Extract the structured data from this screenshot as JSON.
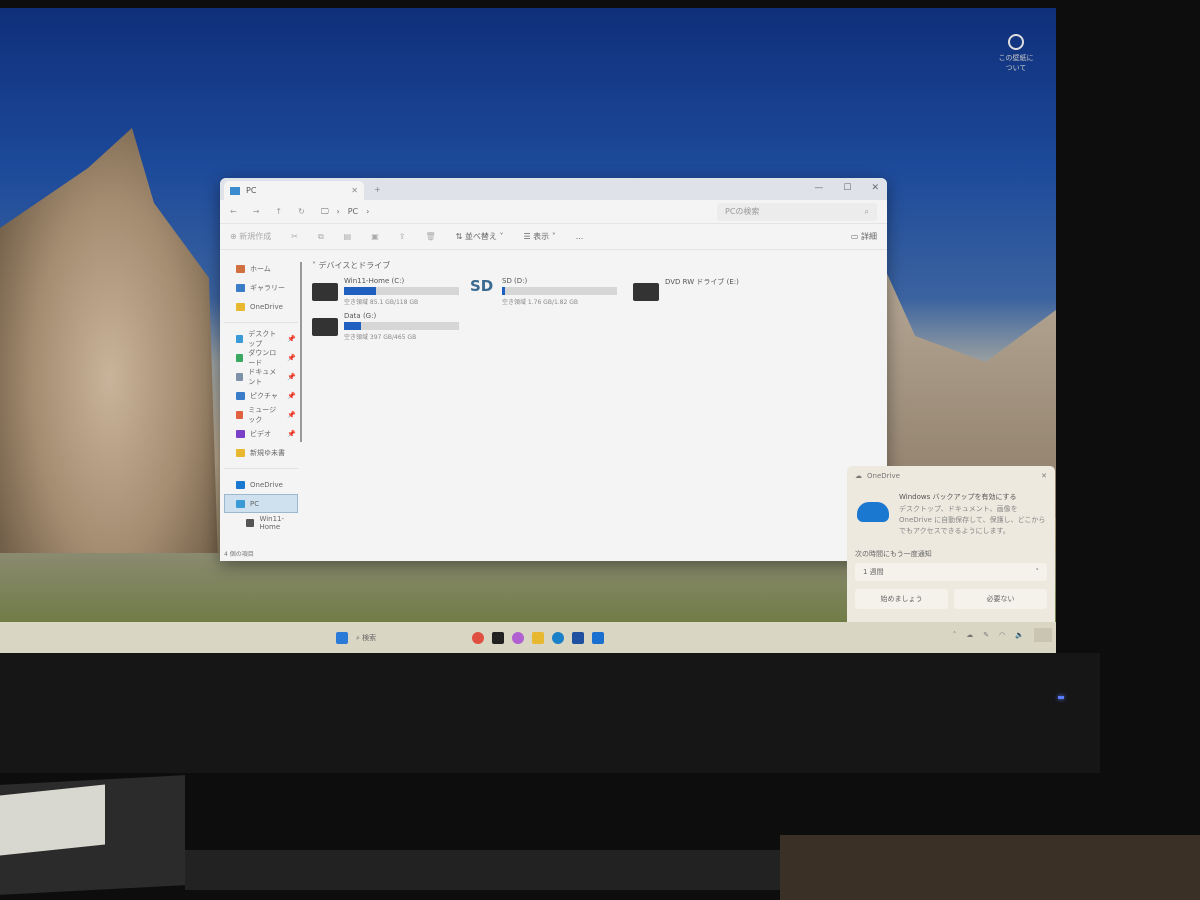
{
  "desktop": {
    "corner_text": "この壁紙について"
  },
  "explorer": {
    "tab_title": "PC",
    "breadcrumb": [
      "PC"
    ],
    "search_placeholder": "PCの検索",
    "toolbar": {
      "new": "新規作成",
      "sort": "並べ替え",
      "view": "表示",
      "more": "...",
      "details": "詳細"
    },
    "nav": [
      {
        "label": "ホーム",
        "color": "#d07040",
        "pin": false
      },
      {
        "label": "ギャラリー",
        "color": "#3a7cc8",
        "pin": false
      },
      {
        "label": "OneDrive",
        "color": "#e8b830",
        "pin": false
      },
      {
        "label": "デスクトップ",
        "color": "#3a9ad8",
        "pin": true
      },
      {
        "label": "ダウンロード",
        "color": "#3aa860",
        "pin": true
      },
      {
        "label": "ドキュメント",
        "color": "#8090a8",
        "pin": true
      },
      {
        "label": "ピクチャ",
        "color": "#3a7cc8",
        "pin": true
      },
      {
        "label": "ミュージック",
        "color": "#e06040",
        "pin": true
      },
      {
        "label": "ビデオ",
        "color": "#7a40c8",
        "pin": true
      },
      {
        "label": "新規ゆ未書",
        "color": "#e8b830",
        "pin": false
      },
      {
        "label": "OneDrive",
        "color": "#1a78d0",
        "pin": false
      },
      {
        "label": "PC",
        "color": "#3a9ad8",
        "pin": false
      },
      {
        "label": "Win11-Home",
        "color": "#555555",
        "pin": false
      }
    ],
    "status": "4 個の項目",
    "section": "デバイスとドライブ",
    "drives": [
      {
        "name": "Win11-Home (C:)",
        "free": "空き領域 85.1 GB/118 GB",
        "used_pct": 28
      },
      {
        "name": "SD (D:)",
        "free": "空き領域 1.76 GB/1.82 GB",
        "used_pct": 3
      },
      {
        "name": "DVD RW ドライブ (E:)",
        "free": "",
        "used_pct": null
      },
      {
        "name": "Data (G:)",
        "free": "空き領域 397 GB/465 GB",
        "used_pct": 15
      }
    ]
  },
  "onedrive": {
    "app": "OneDrive",
    "title": "Windows バックアップを有効にする",
    "body": "デスクトップ、ドキュメント、画像を OneDrive に自動保存して、保護し、どこからでもアクセスできるようにします。",
    "remind_label": "次の時間にもう一度通知",
    "remind_value": "1 週間",
    "start": "始めましょう",
    "decline": "必要ない"
  },
  "taskbar": {
    "search": "検索"
  }
}
